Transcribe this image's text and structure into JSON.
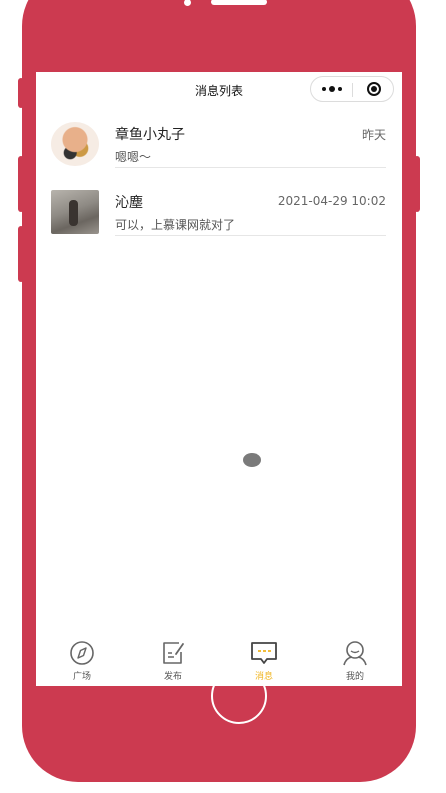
{
  "navbar": {
    "title": "消息列表"
  },
  "messages": [
    {
      "name": "章鱼小丸子",
      "time": "昨天",
      "preview": "嗯嗯～"
    },
    {
      "name": "沁塵",
      "time": "2021-04-29 10:02",
      "preview": "可以，上慕课网就对了"
    }
  ],
  "tabbar": {
    "items": [
      {
        "label": "广场",
        "icon": "compass-icon"
      },
      {
        "label": "发布",
        "icon": "edit-note-icon"
      },
      {
        "label": "消息",
        "icon": "message-icon",
        "active": true
      },
      {
        "label": "我的",
        "icon": "user-icon"
      }
    ]
  },
  "colors": {
    "phone_frame": "#cc3a50",
    "tab_active": "#f0b520",
    "tab_inactive": "#555555"
  }
}
